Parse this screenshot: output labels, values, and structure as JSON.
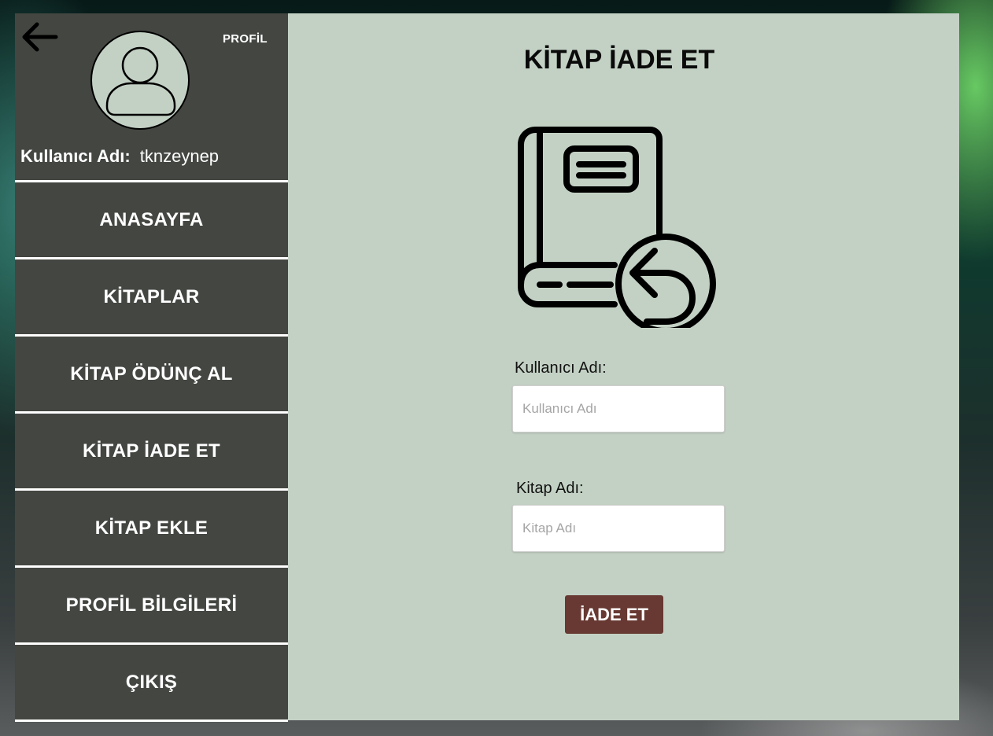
{
  "sidebar": {
    "profile_tag": "PROFİL",
    "username_label": "Kullanıcı Adı:",
    "username_value": "tknzeynep",
    "items": [
      {
        "label": "ANASAYFA"
      },
      {
        "label": "KİTAPLAR"
      },
      {
        "label": "KİTAP ÖDÜNÇ AL"
      },
      {
        "label": "KİTAP İADE ET"
      },
      {
        "label": "KİTAP EKLE"
      },
      {
        "label": "PROFİL BİLGİLERİ"
      },
      {
        "label": "ÇIKIŞ"
      }
    ]
  },
  "main": {
    "title": "KİTAP İADE ET",
    "illustration": "book-return-icon",
    "form": {
      "username_label": "Kullanıcı Adı:",
      "username_placeholder": "Kullanıcı Adı",
      "username_value": "",
      "book_label": "Kitap Adı:",
      "book_placeholder": "Kitap Adı",
      "book_value": "",
      "submit_label": "İADE ET"
    }
  },
  "colors": {
    "sidebar_bg": "#434641",
    "main_bg": "#c3d1c4",
    "button_bg": "#673932",
    "avatar_bg": "#c3d1c4"
  }
}
